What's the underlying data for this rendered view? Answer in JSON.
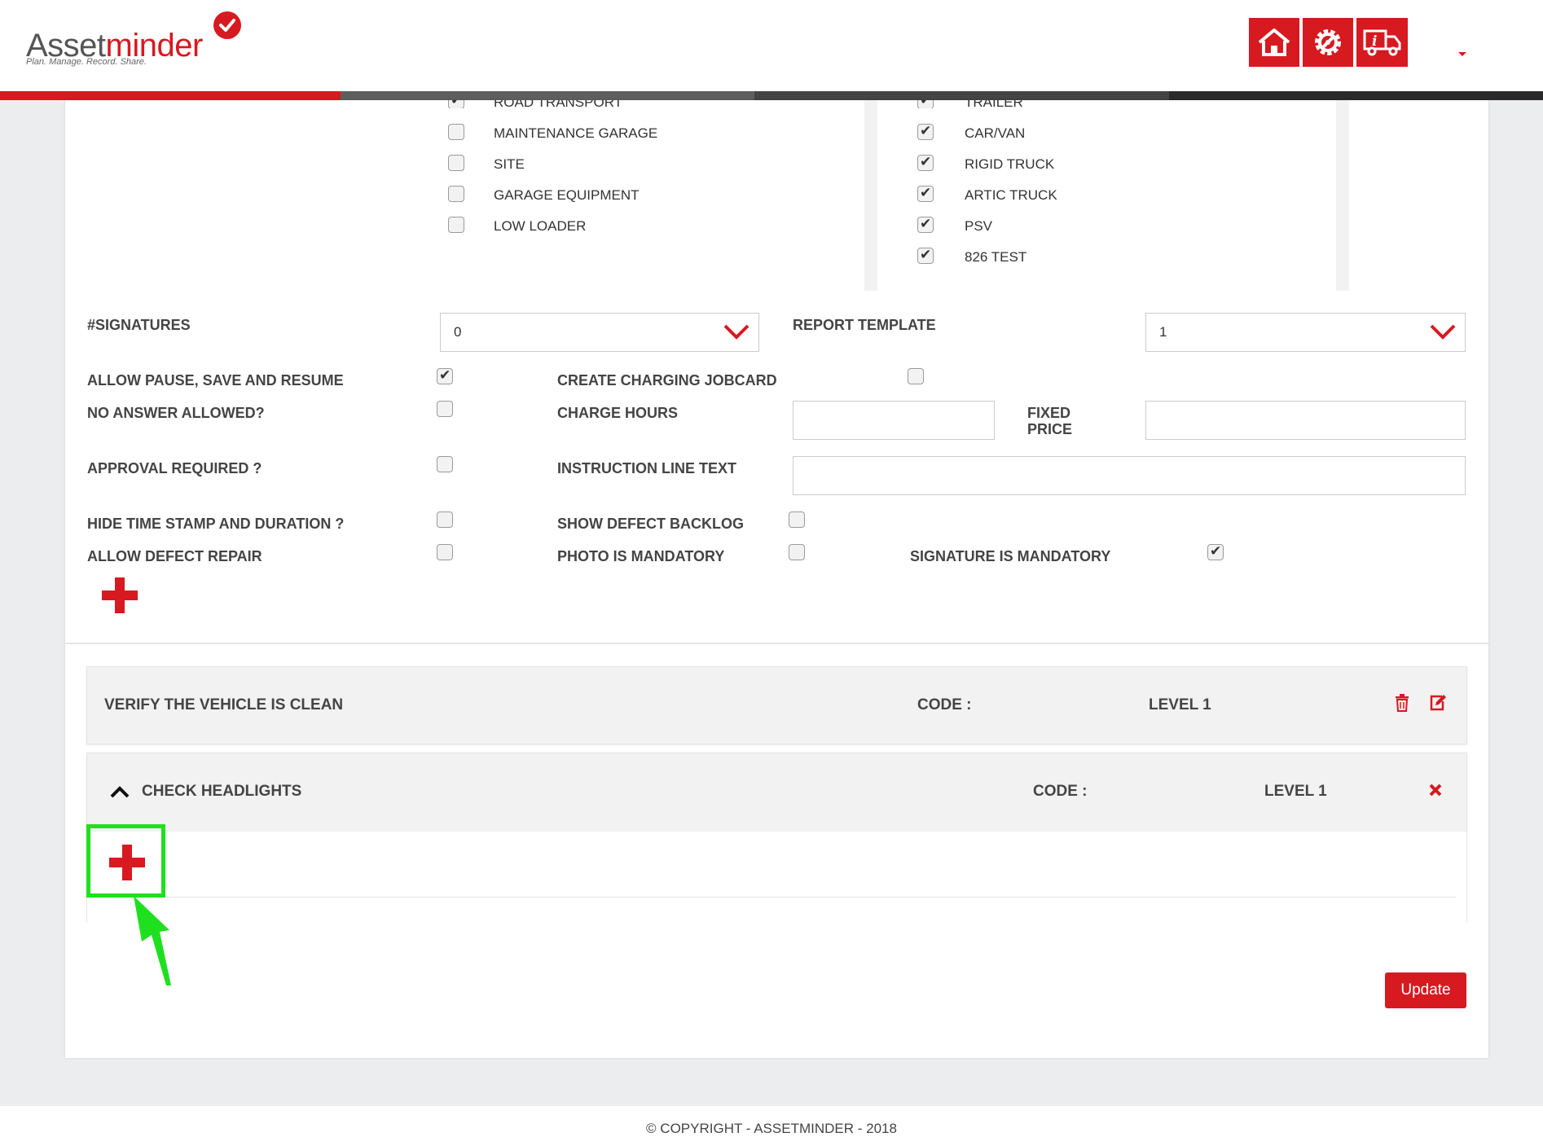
{
  "header": {
    "logo_prefix": "Asset",
    "logo_suffix": "minder",
    "logo_tagline": "Plan. Manage. Record. Share.",
    "icons": [
      "home-icon",
      "settings-gear-icon",
      "truck-info-icon"
    ]
  },
  "types": {
    "left": [
      {
        "label": "ROAD TRANSPORT",
        "checked": true
      },
      {
        "label": "MAINTENANCE GARAGE",
        "checked": false
      },
      {
        "label": "SITE",
        "checked": false
      },
      {
        "label": "GARAGE EQUIPMENT",
        "checked": false
      },
      {
        "label": "LOW LOADER",
        "checked": false
      }
    ],
    "right": [
      {
        "label": "TRAILER",
        "checked": true
      },
      {
        "label": "CAR/VAN",
        "checked": true
      },
      {
        "label": "RIGID TRUCK",
        "checked": true
      },
      {
        "label": "ARTIC TRUCK",
        "checked": true
      },
      {
        "label": "PSV",
        "checked": true
      },
      {
        "label": "826 TEST",
        "checked": true
      }
    ]
  },
  "form": {
    "signatures_label": "#SIGNATURES",
    "signatures_value": "0",
    "report_template_label": "REPORT TEMPLATE",
    "report_template_value": "1",
    "allow_pause_label": "ALLOW PAUSE, SAVE AND RESUME",
    "allow_pause": true,
    "create_charging_label": "CREATE CHARGING JOBCARD",
    "create_charging": false,
    "no_answer_label": "NO ANSWER ALLOWED?",
    "no_answer": false,
    "charge_hours_label": "CHARGE HOURS",
    "charge_hours_value": "",
    "fixed_price_label_1": "FIXED",
    "fixed_price_label_2": "PRICE",
    "fixed_price_value": "",
    "approval_label": "APPROVAL REQUIRED ?",
    "approval": false,
    "instruction_label": "INSTRUCTION LINE TEXT",
    "instruction_value": "",
    "hide_timestamp_label": "HIDE TIME STAMP AND DURATION ?",
    "hide_timestamp": false,
    "show_defect_label": "SHOW DEFECT BACKLOG",
    "show_defect": false,
    "allow_defect_label": "ALLOW DEFECT REPAIR",
    "allow_defect": false,
    "photo_mandatory_label": "PHOTO IS MANDATORY",
    "photo_mandatory": false,
    "signature_mandatory_label": "SIGNATURE IS MANDATORY",
    "signature_mandatory": true
  },
  "checks": [
    {
      "title": "VERIFY THE VEHICLE IS CLEAN",
      "code_label": "CODE :",
      "level": "LEVEL 1"
    },
    {
      "title": "CHECK HEADLIGHTS",
      "code_label": "CODE :",
      "level": "LEVEL 1"
    }
  ],
  "update_label": "Update",
  "footer": "© COPYRIGHT - ASSETMINDER - 2018",
  "colors": {
    "brand_red": "#d71920",
    "highlight_green": "#1fe01f"
  }
}
